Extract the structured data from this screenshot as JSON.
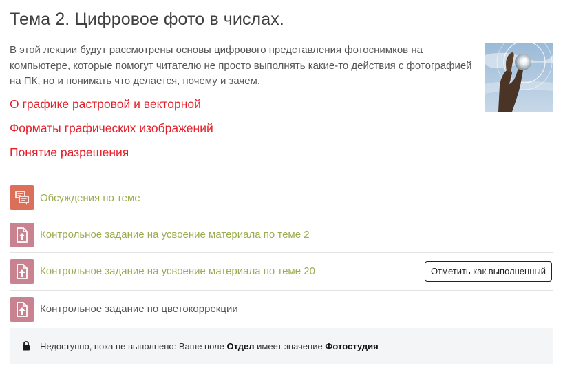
{
  "section": {
    "title": "Тема 2. Цифровое фото в числах.",
    "summary": "В этой лекции будут рассмотрены основы цифрового представления фотоснимков на компьютере, которые помогут читателю не просто выполнять какие-то действия с фотографией на ПК, но и понимать что делается, почему и зачем.",
    "image_icon": "hand-holding-glass-ball-photo"
  },
  "topic_links": [
    {
      "label": "О графике растровой и векторной"
    },
    {
      "label": "Форматы графических изображений"
    },
    {
      "label": "Понятие разрешения"
    }
  ],
  "activities": [
    {
      "label": "Обсуждения по теме",
      "icon": "forum-icon",
      "status": "available"
    },
    {
      "label": "Контрольное задание на усвоение материала по теме 2",
      "icon": "assignment-icon",
      "status": "available"
    },
    {
      "label": "Контрольное задание на усвоение материала по теме 20",
      "icon": "assignment-icon",
      "status": "available",
      "button_label": "Отметить как выполненный"
    },
    {
      "label": "Контрольное задание по цветокоррекции",
      "icon": "assignment-icon",
      "status": "restricted"
    }
  ],
  "restriction": {
    "prefix": "Недоступно, пока не выполнено: Ваше поле ",
    "field": "Отдел",
    "middle": " имеет значение ",
    "value": "Фотостудия",
    "icon": "lock-icon"
  },
  "colors": {
    "link_red": "#e4202a",
    "activity_green": "#9aad4e",
    "forum_icon_bg": "#dc6f5a",
    "assignment_icon_bg": "#c9828f"
  }
}
